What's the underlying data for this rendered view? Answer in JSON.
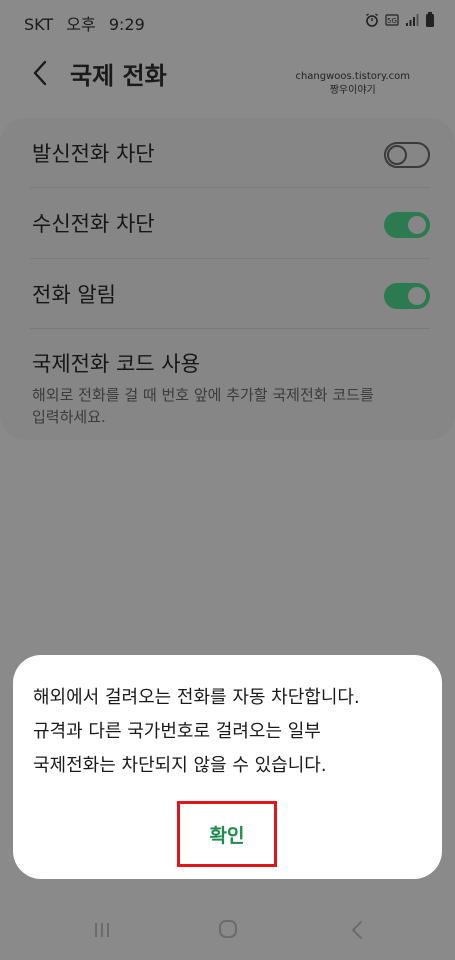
{
  "status_bar": {
    "carrier": "SKT",
    "ampm": "오후",
    "time": "9:29",
    "icons": [
      "alarm-icon",
      "5g-icon",
      "signal-icon",
      "battery-icon"
    ]
  },
  "header": {
    "title": "국제 전화",
    "watermark_line1": "changwoos.tistory.com",
    "watermark_line2": "짱우이야기"
  },
  "settings": {
    "items": [
      {
        "label": "발신전화 차단",
        "toggle": false
      },
      {
        "label": "수신전화 차단",
        "toggle": true
      },
      {
        "label": "전화 알림",
        "toggle": true
      }
    ],
    "intl_code": {
      "label": "국제전화 코드 사용",
      "description_line1": "해외로 전화를 걸 때 번호 앞에 추가할 국제전화 코드를",
      "description_line2": "입력하세요."
    }
  },
  "dialog": {
    "line1": "해외에서 걸려오는 전화를 자동 차단합니다.",
    "line2": "규격과 다른 국가번호로 걸려오는 일부",
    "line3": "국제전화는 차단되지 않을 수 있습니다.",
    "confirm_label": "확인"
  },
  "colors": {
    "accent_green": "#1f8b4c",
    "toggle_on": "#2c7a4f",
    "highlight_red": "#e3151a",
    "dim_background": "#8a8a8a"
  }
}
